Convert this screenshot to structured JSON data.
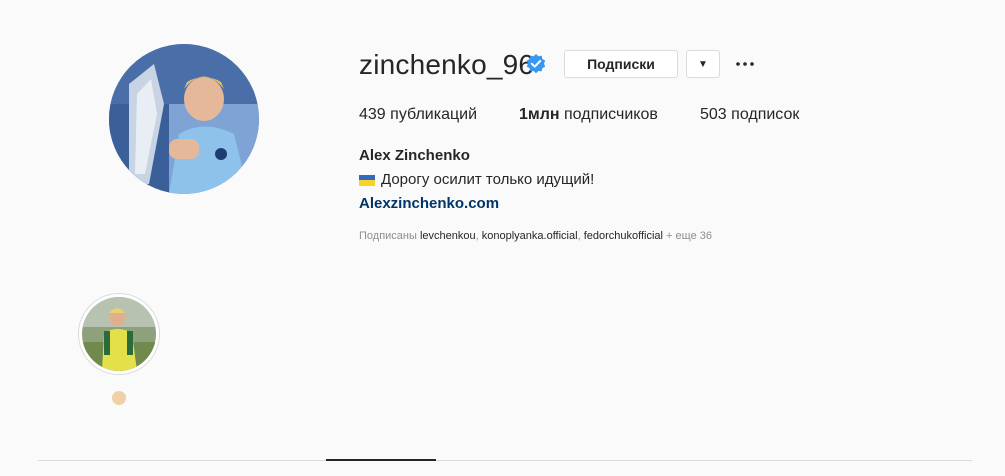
{
  "profile": {
    "username": "zinchenko_96",
    "follow_button": "Подписки",
    "dropdown_glyph": "▼",
    "more_glyph": "•••",
    "verified_icon": "verified-badge-icon",
    "stats": {
      "posts_num": "439",
      "posts_label": "публикаций",
      "followers_num": "1млн",
      "followers_label": "подписчиков",
      "following_num": "503",
      "following_label": "подписок"
    },
    "full_name": "Alex Zinchenko",
    "bio": "Дорогу осилит только идущий!",
    "website": "Alexzinchenko.com",
    "followed_by": {
      "prefix": "Подписаны",
      "users": [
        "levchenkou",
        "konoplyanka.official",
        "fedorchukofficial"
      ],
      "suffix": "+ еще 36"
    }
  },
  "colors": {
    "accent_verified": "#3897f0",
    "link": "#003569",
    "flag_blue": "#2f6cbf",
    "flag_yellow": "#f6d52a"
  }
}
